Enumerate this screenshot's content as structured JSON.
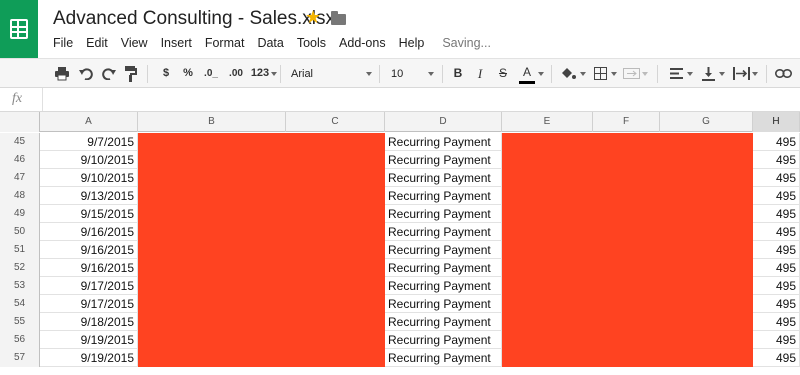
{
  "app": {
    "title": "Advanced Consulting - Sales.xlsx",
    "logo_icon": "sheets-logo-icon",
    "accent_color": "#0f9d58"
  },
  "menu": {
    "items": [
      "File",
      "Edit",
      "View",
      "Insert",
      "Format",
      "Data",
      "Tools",
      "Add-ons",
      "Help"
    ],
    "status": "Saving..."
  },
  "toolbar": {
    "currency": "$",
    "percent": "%",
    "decrease_decimals": ".0_",
    "increase_decimals": ".00",
    "more_formats": "123",
    "font": "Arial",
    "font_size": "10",
    "bold": "B",
    "italic": "I",
    "strikethrough": "S",
    "text_color": "A",
    "text_color_value": "#000000"
  },
  "formula_bar": {
    "icon": "fx",
    "value": ""
  },
  "columns": [
    "A",
    "B",
    "C",
    "D",
    "E",
    "F",
    "G",
    "H"
  ],
  "selected_column": "H",
  "redaction_color": "#ff4321",
  "rows": [
    {
      "num": "45",
      "date": "9/7/2015",
      "desc": "Recurring Payment",
      "amount": "495"
    },
    {
      "num": "46",
      "date": "9/10/2015",
      "desc": "Recurring Payment",
      "amount": "495"
    },
    {
      "num": "47",
      "date": "9/10/2015",
      "desc": "Recurring Payment",
      "amount": "495"
    },
    {
      "num": "48",
      "date": "9/13/2015",
      "desc": "Recurring Payment",
      "amount": "495"
    },
    {
      "num": "49",
      "date": "9/15/2015",
      "desc": "Recurring Payment",
      "amount": "495"
    },
    {
      "num": "50",
      "date": "9/16/2015",
      "desc": "Recurring Payment",
      "amount": "495"
    },
    {
      "num": "51",
      "date": "9/16/2015",
      "desc": "Recurring Payment",
      "amount": "495"
    },
    {
      "num": "52",
      "date": "9/16/2015",
      "desc": "Recurring Payment",
      "amount": "495"
    },
    {
      "num": "53",
      "date": "9/17/2015",
      "desc": "Recurring Payment",
      "amount": "495"
    },
    {
      "num": "54",
      "date": "9/17/2015",
      "desc": "Recurring Payment",
      "amount": "495"
    },
    {
      "num": "55",
      "date": "9/18/2015",
      "desc": "Recurring Payment",
      "amount": "495"
    },
    {
      "num": "56",
      "date": "9/19/2015",
      "desc": "Recurring Payment",
      "amount": "495"
    },
    {
      "num": "57",
      "date": "9/19/2015",
      "desc": "Recurring Payment",
      "amount": "495"
    }
  ]
}
